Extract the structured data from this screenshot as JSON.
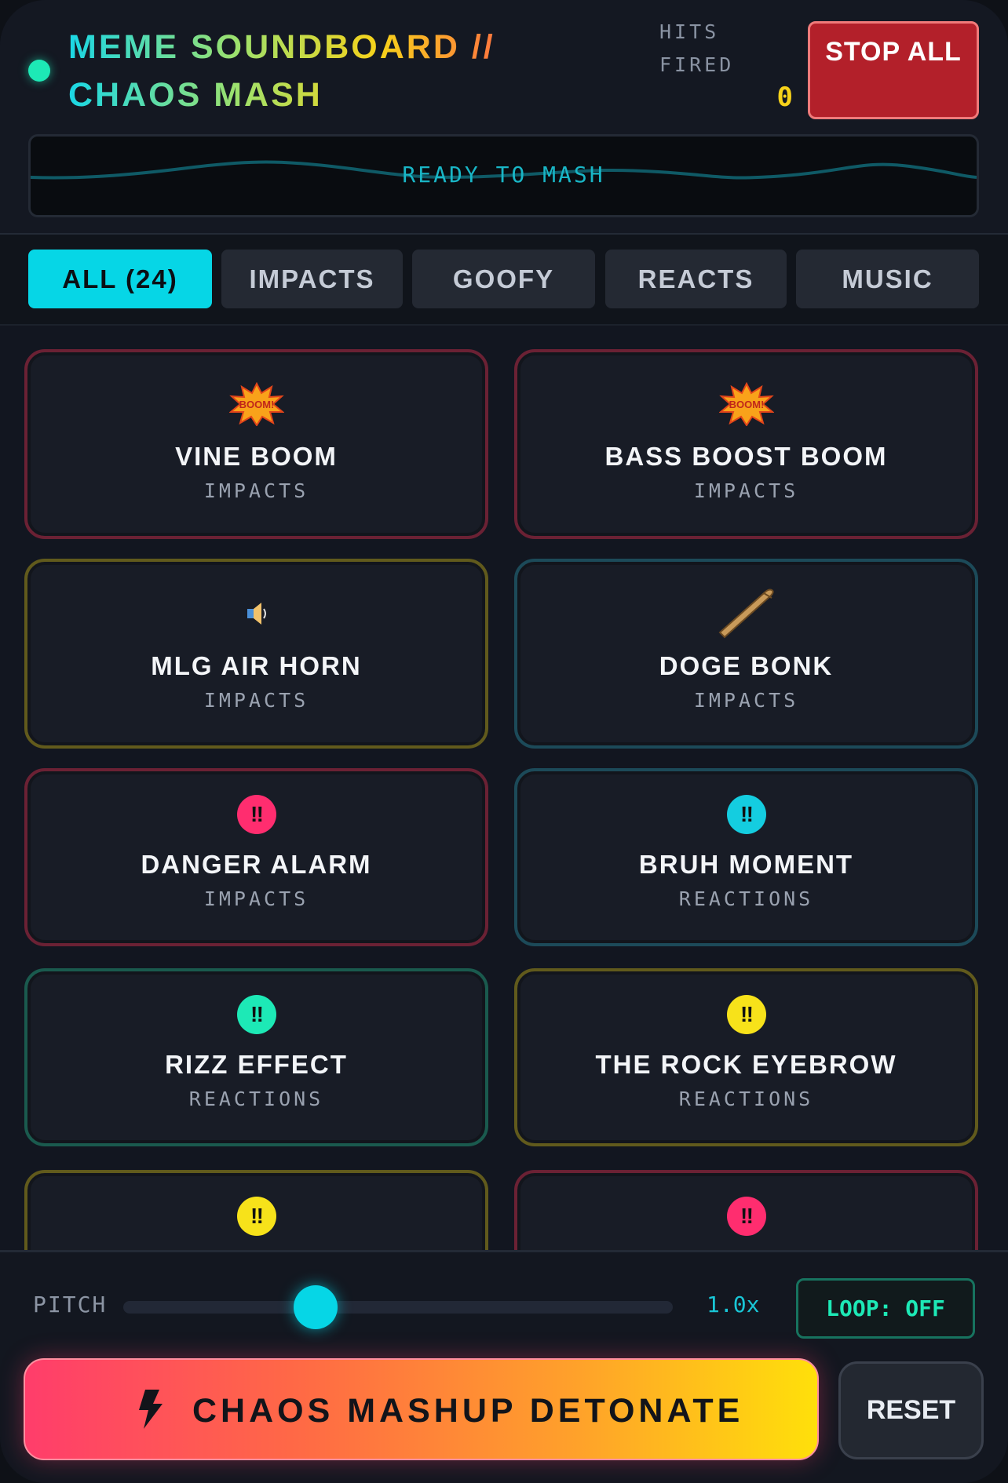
{
  "header": {
    "title": "MEME SOUNDBOARD // CHAOS MASH",
    "hits_label": "HITS FIRED",
    "hits_value": "0",
    "stop_label": "STOP ALL",
    "wave_status": "READY TO MASH"
  },
  "tabs": [
    {
      "label": "ALL (24)",
      "active": true
    },
    {
      "label": "IMPACTS",
      "active": false
    },
    {
      "label": "GOOFY",
      "active": false
    },
    {
      "label": "REACTS",
      "active": false
    },
    {
      "label": "MUSIC",
      "active": false
    }
  ],
  "sounds": [
    {
      "name": "VINE BOOM",
      "category": "IMPACTS",
      "icon": "boom-icon",
      "accent": "red"
    },
    {
      "name": "BASS BOOST BOOM",
      "category": "IMPACTS",
      "icon": "boom-icon",
      "accent": "red"
    },
    {
      "name": "MLG AIR HORN",
      "category": "IMPACTS",
      "icon": "speaker-icon",
      "accent": "olive"
    },
    {
      "name": "DOGE BONK",
      "category": "IMPACTS",
      "icon": "bat-icon",
      "accent": "teal"
    },
    {
      "name": "DANGER ALARM",
      "category": "IMPACTS",
      "icon": "double-exclamation-icon",
      "accent": "red",
      "badge_color": "#ff2d6f",
      "badge_text": "‼"
    },
    {
      "name": "BRUH MOMENT",
      "category": "REACTIONS",
      "icon": "double-exclamation-icon",
      "accent": "teal",
      "badge_color": "#14cde0",
      "badge_text": "‼"
    },
    {
      "name": "RIZZ EFFECT",
      "category": "REACTIONS",
      "icon": "double-exclamation-icon",
      "accent": "green",
      "badge_color": "#1de9b6",
      "badge_text": "‼"
    },
    {
      "name": "THE ROCK EYEBROW",
      "category": "REACTIONS",
      "icon": "double-exclamation-icon",
      "accent": "olive",
      "badge_color": "#f7e21a",
      "badge_text": "‼"
    },
    {
      "icon": "double-exclamation-icon",
      "accent": "olive",
      "badge_color": "#f7e21a",
      "badge_text": "‼"
    },
    {
      "icon": "double-exclamation-icon",
      "accent": "red",
      "badge_color": "#ff2d6f",
      "badge_text": "‼"
    }
  ],
  "controls": {
    "pitch_label": "PITCH",
    "pitch_value": "1.0x",
    "pitch_fraction": 0.35,
    "loop_label": "LOOP: OFF",
    "detonate_label": "CHAOS MASHUP DETONATE",
    "reset_label": "RESET"
  },
  "colors": {
    "accent": "#06d6e6",
    "danger": "#b3202a",
    "hits": "#f7d21a",
    "loop": "#1de9b6"
  }
}
